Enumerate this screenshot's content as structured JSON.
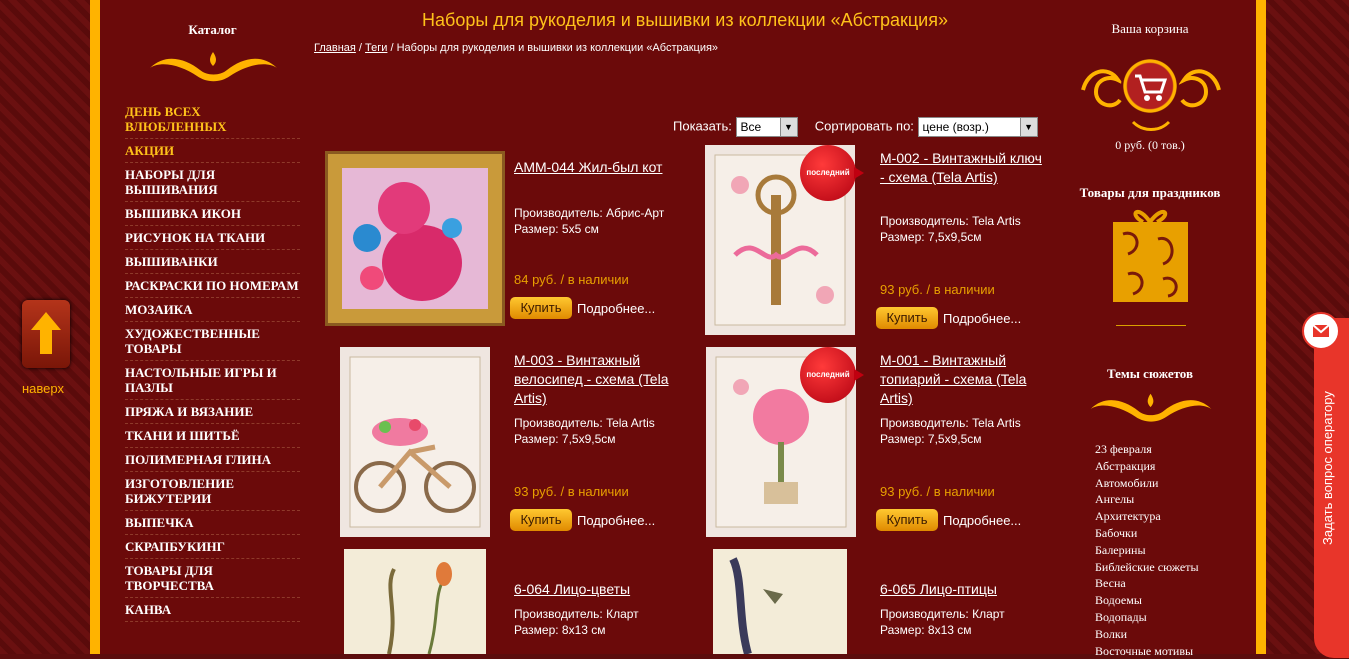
{
  "up": {
    "label": "наверх"
  },
  "catalog": {
    "title": "Каталог",
    "items": [
      {
        "label": "ДЕНЬ ВСЕХ ВЛЮБЛЕННЫХ",
        "highlight": true
      },
      {
        "label": "АКЦИИ",
        "highlight": true
      },
      {
        "label": "НАБОРЫ ДЛЯ ВЫШИВАНИЯ"
      },
      {
        "label": "ВЫШИВКА ИКОН"
      },
      {
        "label": "РИСУНОК НА ТКАНИ"
      },
      {
        "label": "ВЫШИВАНКИ"
      },
      {
        "label": "РАСКРАСКИ ПО НОМЕРАМ"
      },
      {
        "label": "МОЗАИКА"
      },
      {
        "label": "ХУДОЖЕСТВЕННЫЕ ТОВАРЫ"
      },
      {
        "label": "НАСТОЛЬНЫЕ ИГРЫ И ПАЗЛЫ"
      },
      {
        "label": "ПРЯЖА И ВЯЗАНИЕ"
      },
      {
        "label": "ТКАНИ И ШИТЬЁ"
      },
      {
        "label": "ПОЛИМЕРНАЯ ГЛИНА"
      },
      {
        "label": "ИЗГОТОВЛЕНИЕ БИЖУТЕРИИ"
      },
      {
        "label": "ВЫПЕЧКА"
      },
      {
        "label": "СКРАПБУКИНГ"
      },
      {
        "label": "ТОВАРЫ ДЛЯ ТВОРЧЕСТВА"
      },
      {
        "label": "КАНВА"
      }
    ]
  },
  "main": {
    "title": "Наборы для рукоделия и вышивки из коллекции «Абстракция»",
    "breadcrumb": {
      "home": "Главная",
      "sep1": " / ",
      "tags": "Теги",
      "sep2": " / ",
      "current": "Наборы для рукоделия и вышивки из коллекции «Абстракция»"
    },
    "show_label": "Показать:",
    "show_value": "Все",
    "sort_label": "Сортировать по:",
    "sort_value": "цене (возр.)",
    "buy_label": "Купить",
    "more_label": "Подробнее...",
    "badge_label": "последний",
    "products": [
      {
        "name": "АММ-044 Жил-был кот",
        "maker": "Производитель: Абрис-Арт",
        "size": "Размер: 5х5 см",
        "price": "84 руб. / в наличии"
      },
      {
        "name": "M-002 - Винтажный ключ - схема (Tela Artis)",
        "maker": "Производитель: Tela Artis",
        "size": "Размер: 7,5х9,5см",
        "price": "93 руб. / в наличии"
      },
      {
        "name": "M-003 - Винтажный велосипед - схема (Tela Artis)",
        "maker": "Производитель: Tela Artis",
        "size": "Размер: 7,5х9,5см",
        "price": "93 руб. / в наличии"
      },
      {
        "name": "M-001 - Винтажный топиарий - схема (Tela Artis)",
        "maker": "Производитель: Tela Artis",
        "size": "Размер: 7,5х9,5см",
        "price": "93 руб. / в наличии"
      },
      {
        "name": "6-064 Лицо-цветы",
        "maker": "Производитель: Кларт",
        "size": "Размер: 8х13 см"
      },
      {
        "name": "6-065 Лицо-птицы",
        "maker": "Производитель: Кларт",
        "size": "Размер: 8х13 см"
      }
    ]
  },
  "right": {
    "cart_title": "Ваша корзина",
    "cart_sum": "0 руб.   (0 тов.)",
    "holiday_title": "Товары для праздников",
    "topics_title": "Темы сюжетов",
    "topics": [
      "23 февраля",
      "Абстракция",
      "Автомобили",
      "Ангелы",
      "Архитектура",
      "Бабочки",
      "Балерины",
      "Библейские сюжеты",
      "Весна",
      "Водоемы",
      "Водопады",
      "Волки",
      "Восточные мотивы"
    ]
  },
  "ask": {
    "label": "Задать вопрос оператору"
  }
}
